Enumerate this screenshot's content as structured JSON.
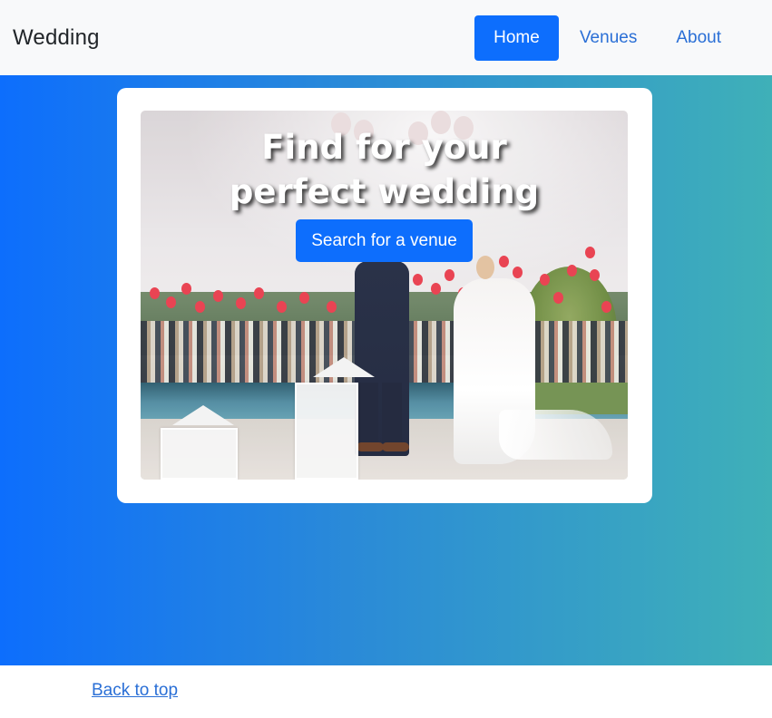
{
  "navbar": {
    "brand": "Wedding",
    "links": [
      {
        "label": "Home",
        "active": true
      },
      {
        "label": "Venues",
        "active": false
      },
      {
        "label": "About",
        "active": false
      }
    ]
  },
  "hero": {
    "title": "Find for your perfect wedding venue.",
    "button_label": "Search for a venue",
    "image_alt": "wedding-couple-at-poolside-with-red-balloons"
  },
  "footer": {
    "back_to_top": "Back to top"
  },
  "colors": {
    "primary": "#0d6efd",
    "link": "#2a6fd6",
    "gradient_start": "#0d6efd",
    "gradient_end": "#3fb0b8",
    "navbar_bg": "#f8f9fa"
  }
}
